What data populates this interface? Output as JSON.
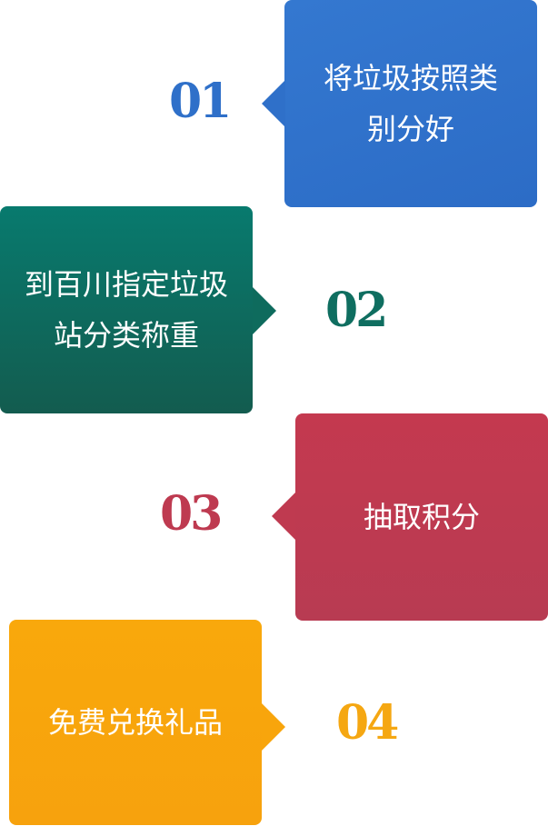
{
  "steps": [
    {
      "number": "01",
      "text": "将垃圾按照类别分好",
      "color": "#2f70c9"
    },
    {
      "number": "02",
      "text": "到百川指定垃圾站分类称重",
      "color": "#0e6b5d"
    },
    {
      "number": "03",
      "text": "抽取积分",
      "color": "#bf3a50"
    },
    {
      "number": "04",
      "text": "免费兑换礼品",
      "color": "#f8a50c"
    }
  ]
}
